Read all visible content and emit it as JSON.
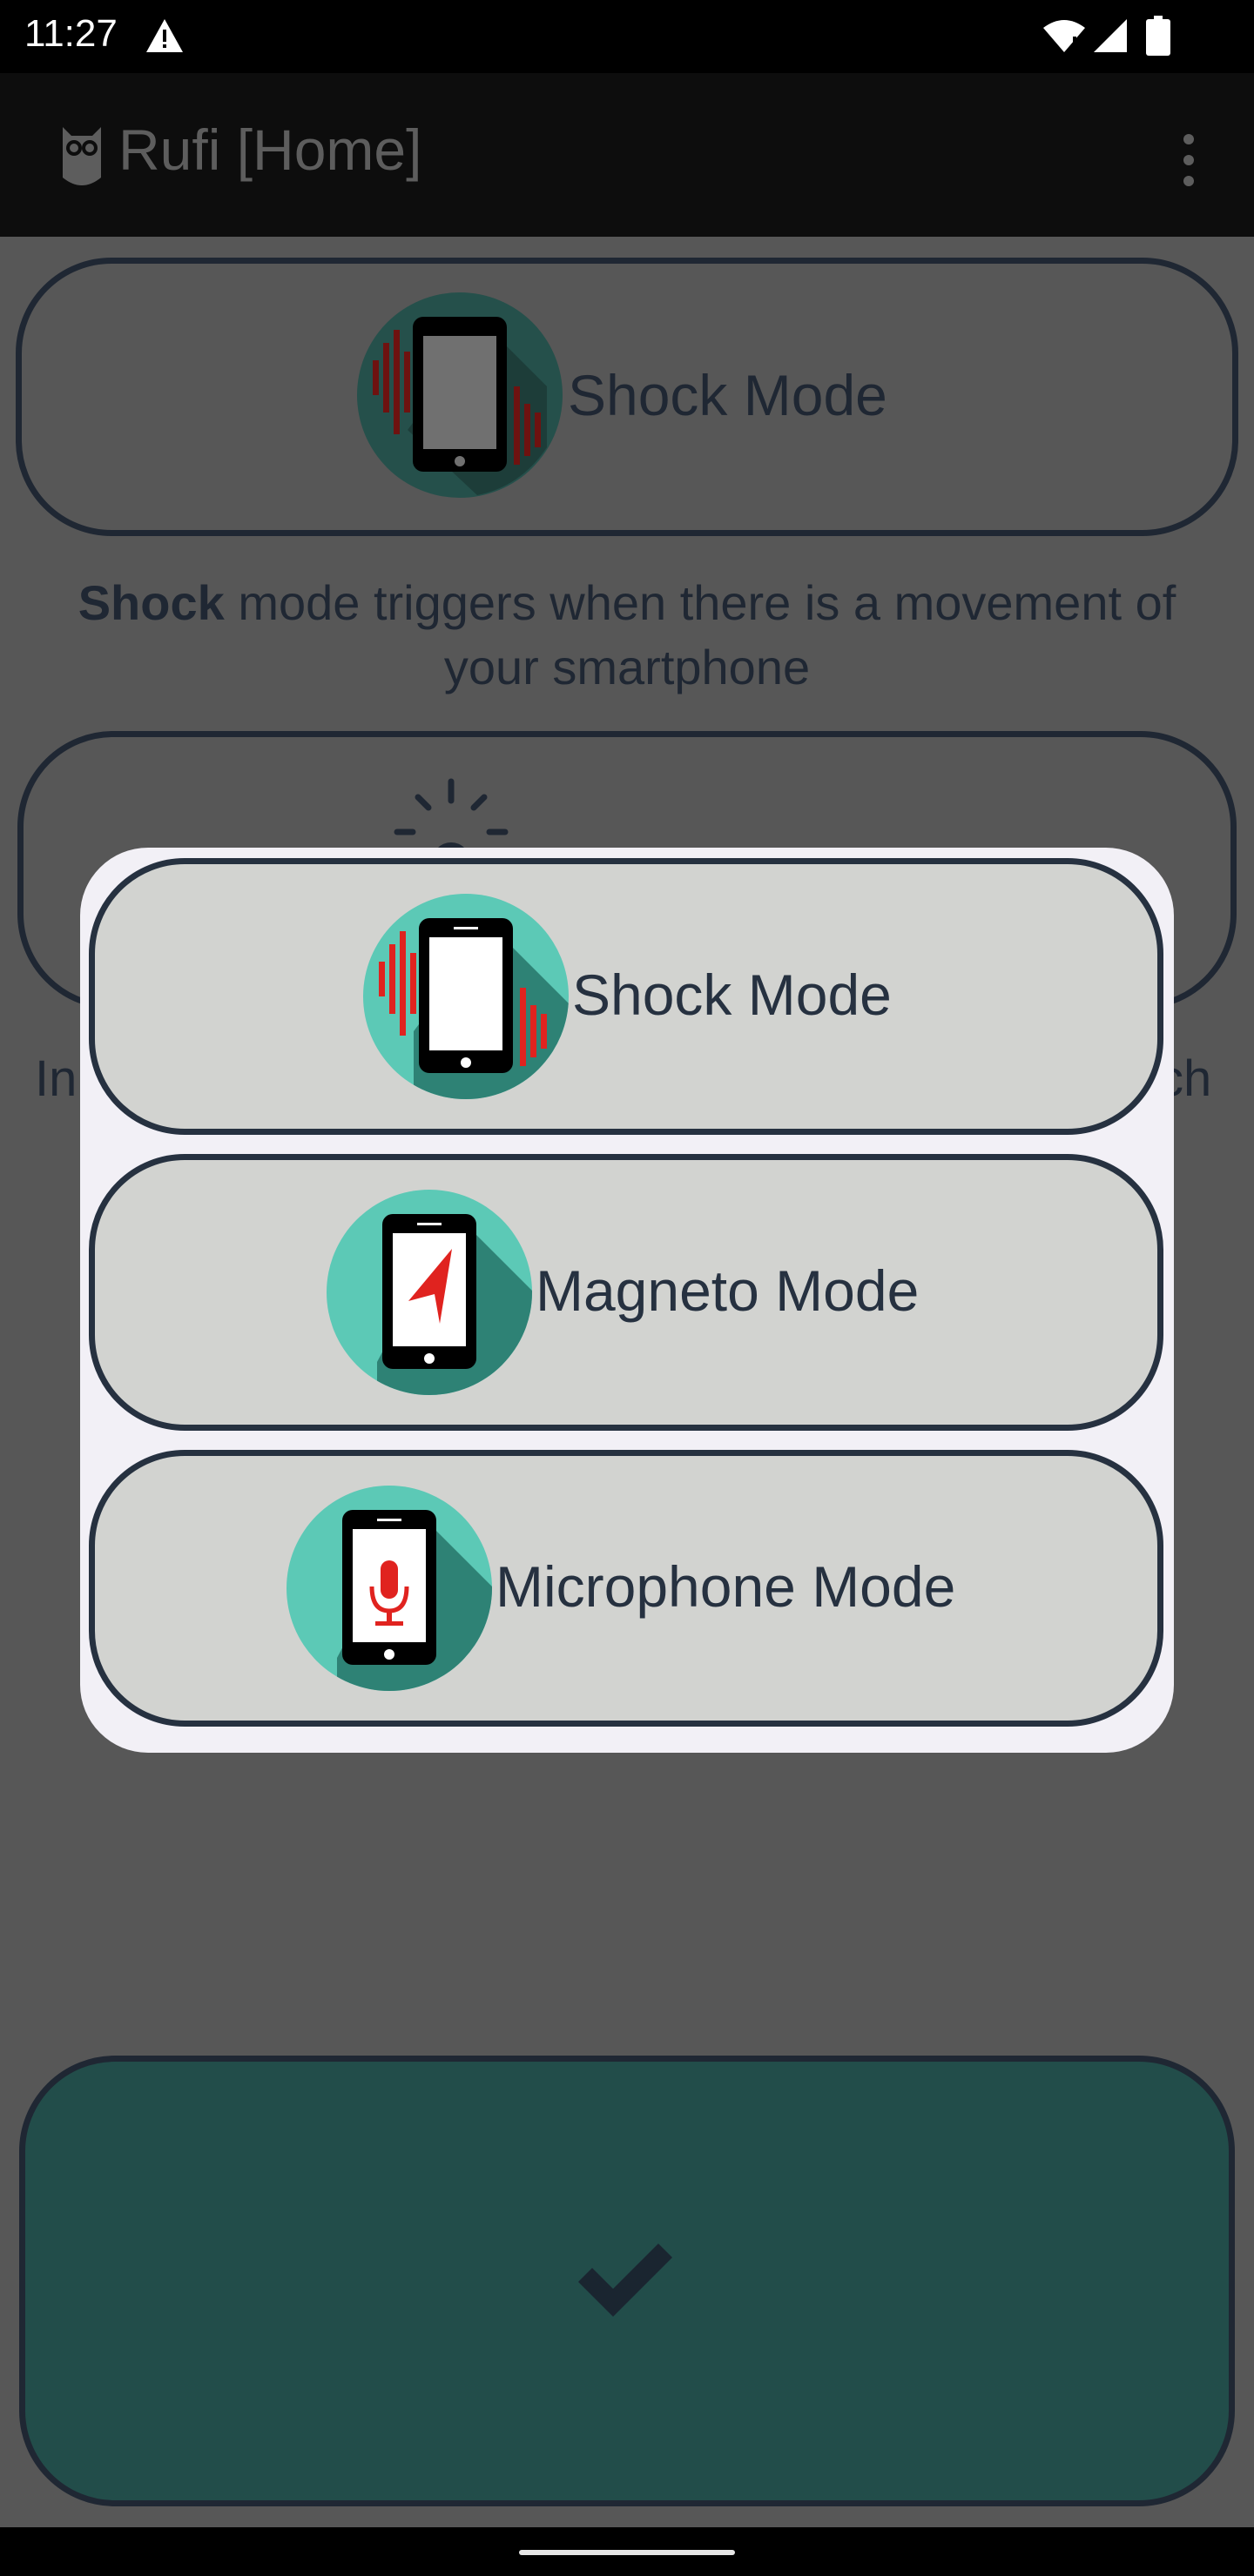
{
  "status_bar": {
    "time": "11:27",
    "icons": [
      "warning-icon",
      "wifi-icon",
      "cell-signal-icon",
      "battery-icon"
    ]
  },
  "app_bar": {
    "title": "Rufi [Home]",
    "logo_icon": "owl-logo-icon",
    "menu_icon": "overflow-menu-icon"
  },
  "background": {
    "shock_card_label": "Shock Mode",
    "shock_desc_bold": "Shock",
    "shock_desc_rest": " mode triggers when there is a movement of your smartphone",
    "light_desc_visible_left": "In",
    "light_desc_visible_right": "ch",
    "confirm_icon": "checkmark-icon"
  },
  "dialog": {
    "options": [
      {
        "label": "Shock Mode",
        "icon": "phone-vibration-icon"
      },
      {
        "label": "Magneto Mode",
        "icon": "phone-compass-icon"
      },
      {
        "label": "Microphone Mode",
        "icon": "phone-microphone-icon"
      }
    ]
  },
  "colors": {
    "teal_circle": "#5cc9b6",
    "teal_shadow": "#2e8275",
    "card_border": "#263140",
    "card_fill": "#d2d3d0",
    "dialog_bg": "#f2f0f6",
    "confirm_bg": "#224d4a",
    "accent_red": "#e0231f"
  }
}
